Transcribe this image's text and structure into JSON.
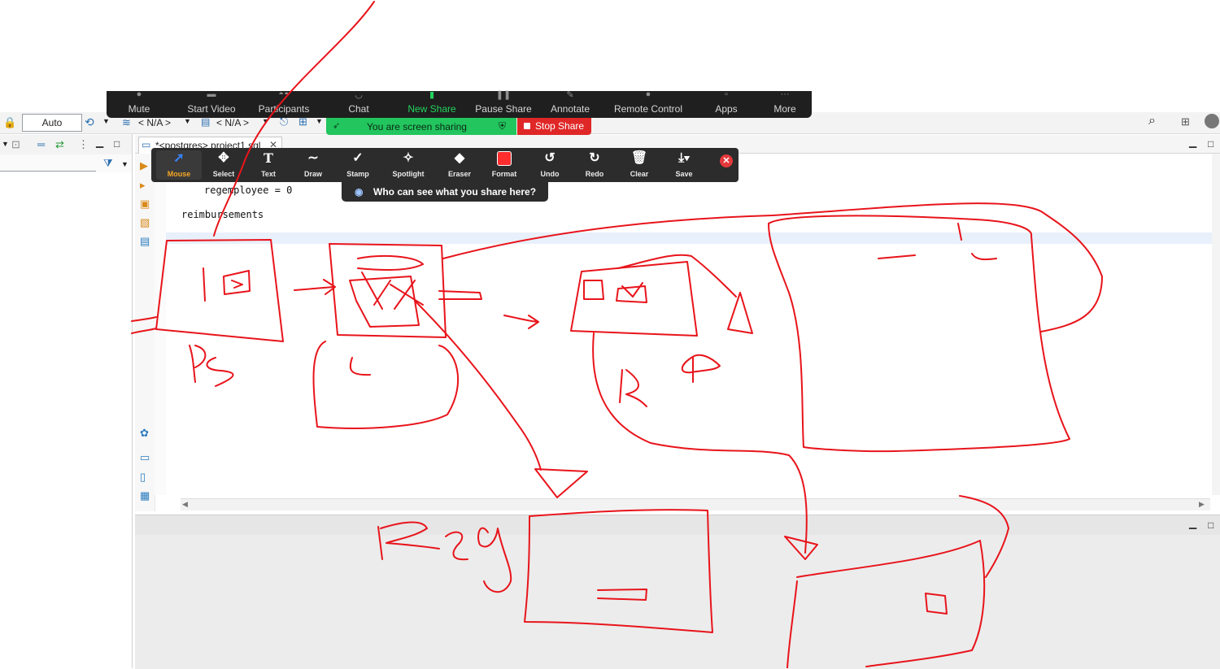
{
  "zoom_bar": {
    "buttons": [
      {
        "label": "Mute",
        "icon": "microphone-icon"
      },
      {
        "label": "Start Video",
        "icon": "video-off-icon"
      },
      {
        "label": "Participants",
        "icon": "participants-icon"
      },
      {
        "label": "Chat",
        "icon": "chat-icon"
      },
      {
        "label": "New Share",
        "icon": "share-icon"
      },
      {
        "label": "Pause Share",
        "icon": "pause-icon"
      },
      {
        "label": "Annotate",
        "icon": "pen-icon"
      },
      {
        "label": "Remote Control",
        "icon": "remote-control-icon"
      },
      {
        "label": "Apps",
        "icon": "apps-icon"
      },
      {
        "label": "More",
        "icon": "more-icon"
      }
    ],
    "sharing_text": "You are screen sharing",
    "stop_share_label": "Stop Share"
  },
  "annotate_bar": {
    "tools": [
      {
        "label": "Mouse",
        "icon": "cursor-arrow-icon",
        "active": true
      },
      {
        "label": "Select",
        "icon": "move-icon"
      },
      {
        "label": "Text",
        "icon": "text-t-icon"
      },
      {
        "label": "Draw",
        "icon": "squiggle-icon"
      },
      {
        "label": "Stamp",
        "icon": "checkmark-icon"
      },
      {
        "label": "Spotlight",
        "icon": "spotlight-wand-icon"
      },
      {
        "label": "Eraser",
        "icon": "eraser-icon"
      },
      {
        "label": "Format",
        "icon": "color-square-icon"
      },
      {
        "label": "Undo",
        "icon": "undo-icon"
      },
      {
        "label": "Redo",
        "icon": "redo-icon"
      },
      {
        "label": "Clear",
        "icon": "trash-icon"
      },
      {
        "label": "Save",
        "icon": "save-download-icon"
      }
    ],
    "tooltip": "Who can see what you share here?",
    "active_color": "#f5a623",
    "format_color": "#ff2d2d"
  },
  "ide": {
    "toolbar": {
      "mode_value": "Auto",
      "datasource_value": "< N/A >",
      "schema_value": "< N/A >"
    },
    "tab_title": "*<postgres> project1.sql",
    "code_lines": [
      "regemployee = 0",
      "reimbursements"
    ]
  },
  "drawing": {
    "stroke_color": "#e8141b",
    "text_marks": [
      "ps",
      "R",
      "Reg"
    ]
  }
}
